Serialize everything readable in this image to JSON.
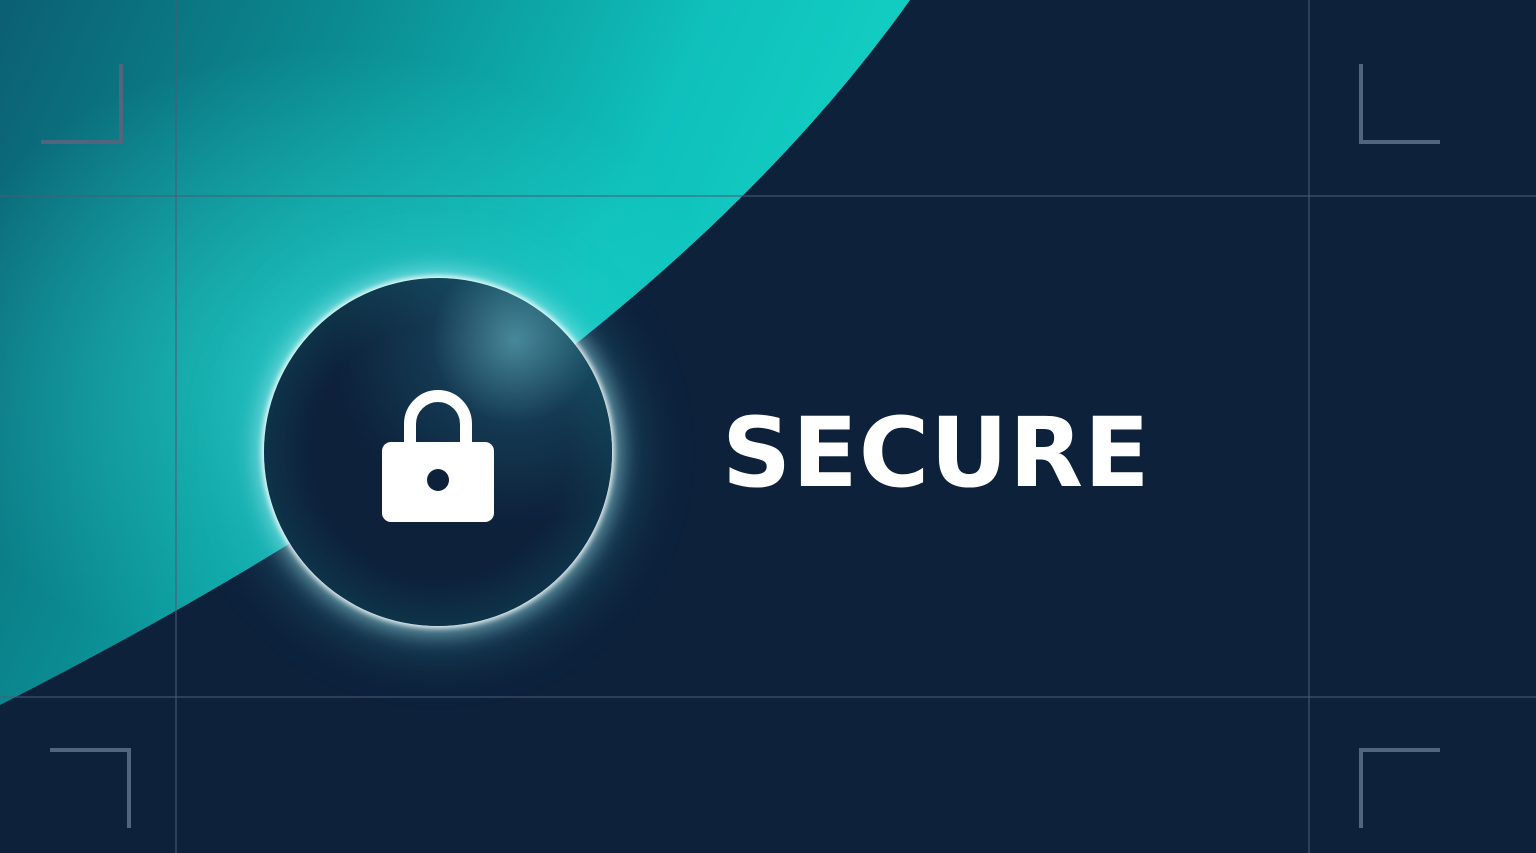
{
  "hero": {
    "title": "SECURE",
    "icon": "padlock-icon"
  },
  "colors": {
    "background": "#0d213b",
    "accent_teal": "#14c8be",
    "grid_line": "#3a4d66",
    "text": "#ffffff"
  }
}
